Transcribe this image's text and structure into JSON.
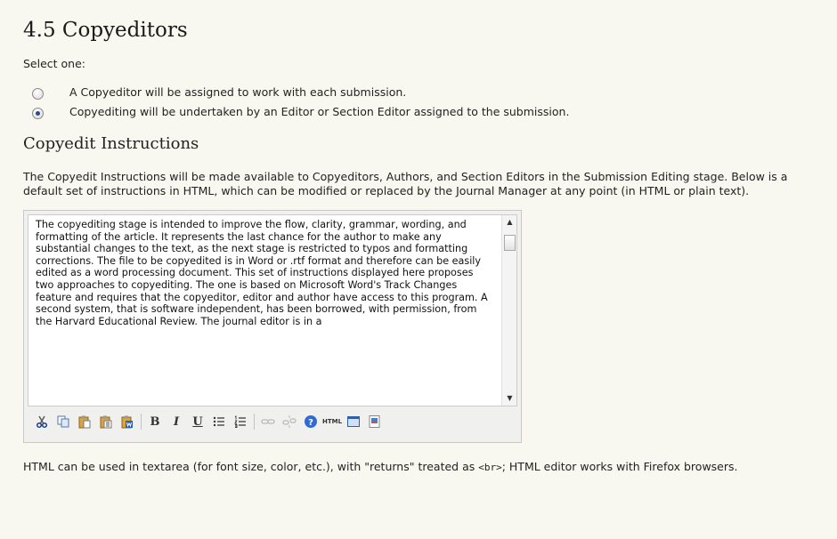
{
  "section": {
    "title": "4.5 Copyeditors",
    "select_label": "Select one:",
    "options": [
      {
        "label": "A Copyeditor will be assigned to work with each submission.",
        "checked": false
      },
      {
        "label": "Copyediting will be undertaken by an Editor or Section Editor assigned to the submission.",
        "checked": true
      }
    ]
  },
  "instructions": {
    "heading": "Copyedit Instructions",
    "description": "The Copyedit Instructions will be made available to Copyeditors, Authors, and Section Editors in the Submission Editing stage. Below is a default set of instructions in HTML, which can be modified or replaced by the Journal Manager at any point (in HTML or plain text).",
    "editor_text": "The copyediting stage is intended to improve the flow, clarity, grammar, wording, and formatting of the article. It represents the last chance for the author to make any substantial changes to the text, as the next stage is restricted to typos and formatting corrections. The file to be copyedited is in Word or .rtf format and therefore can be easily edited as a word processing document. This set of instructions displayed here proposes two approaches to copyediting. The one is based on Microsoft Word's Track Changes feature and requires that the copyeditor, editor and author have access to this program. A second system, that is software independent, has been borrowed, with permission, from the Harvard Educational Review. The journal editor is in a"
  },
  "toolbar": {
    "bold": "B",
    "italic": "I",
    "underline": "U",
    "html": "HTML",
    "icons": [
      "cut-icon",
      "copy-icon",
      "paste-icon",
      "paste-text-icon",
      "paste-word-icon",
      "bullet-list-icon",
      "numbered-list-icon",
      "link-icon",
      "unlink-icon",
      "help-icon",
      "html-icon",
      "fullscreen-icon",
      "image-icon"
    ]
  },
  "footnote": {
    "before": "HTML can be used in textarea (for font size, color, etc.), with \"returns\" treated as ",
    "code": "<br>",
    "after": "; HTML editor works with Firefox browsers."
  },
  "colors": {
    "background": "#f8f8f0",
    "radio_checked": "#2a4a8e"
  }
}
